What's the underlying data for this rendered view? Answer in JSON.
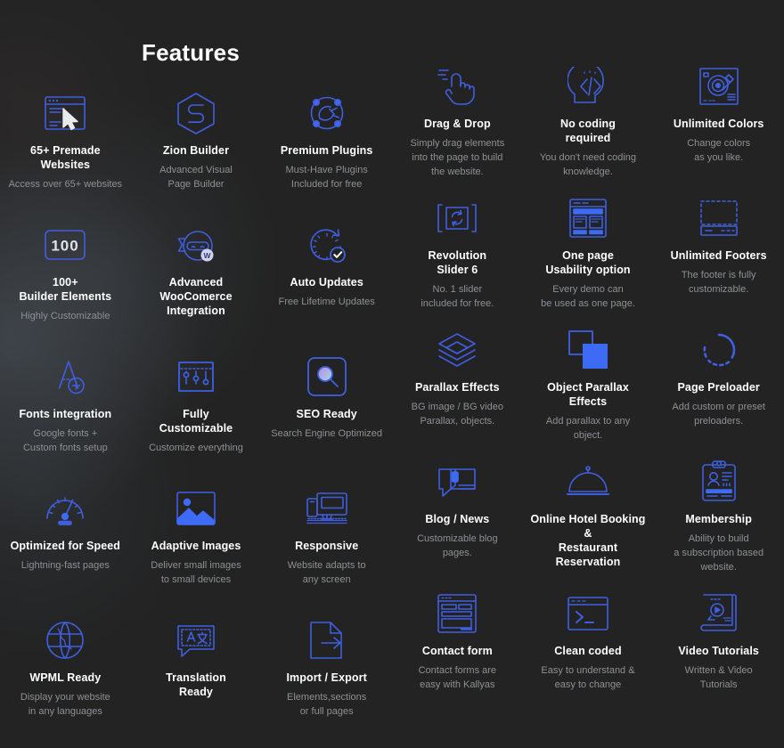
{
  "page": {
    "title": "Features"
  },
  "colors": {
    "background": "#232323",
    "accent_blue": "#3f5fe0",
    "accent_blue_bright": "#3d6bf5",
    "title_text": "#ffffff",
    "body_text": "#8d9095",
    "badge_light": "#cfd4f2",
    "seo_gradient_from": "#b48ad8",
    "seo_gradient_to": "#a8d8ee"
  },
  "left_group": [
    {
      "icon": "premade-websites-icon",
      "title": "65+ Premade\nWebsites",
      "desc": "Access over 65+ websites"
    },
    {
      "icon": "zion-builder-icon",
      "title": "Zion Builder",
      "desc": "Advanced Visual\nPage Builder"
    },
    {
      "icon": "premium-plugins-icon",
      "title": "Premium Plugins",
      "desc": "Must-Have Plugins\nIncluded for free"
    },
    {
      "icon": "builder-elements-icon",
      "title": "100+\nBuilder Elements",
      "desc": "Highly Customizable"
    },
    {
      "icon": "woocommerce-ninja-icon",
      "title": "Advanced\nWooComerce\nIntegration",
      "desc": ""
    },
    {
      "icon": "auto-updates-icon",
      "title": "Auto Updates",
      "desc": "Free Lifetime Updates"
    },
    {
      "icon": "fonts-integration-icon",
      "title": "Fonts integration",
      "desc": "Google fonts +\nCustom fonts setup"
    },
    {
      "icon": "fully-customizable-icon",
      "title": "Fully\nCustomizable",
      "desc": "Customize everything"
    },
    {
      "icon": "seo-ready-icon",
      "title": "SEO Ready",
      "desc": "Search Engine Optimized"
    },
    {
      "icon": "speed-gauge-icon",
      "title": "Optimized for Speed",
      "desc": "Lightning-fast pages"
    },
    {
      "icon": "adaptive-images-icon",
      "title": "Adaptive Images",
      "desc": "Deliver small images\nto small devices"
    },
    {
      "icon": "responsive-icon",
      "title": "Responsive",
      "desc": "Website adapts to\nany screen"
    },
    {
      "icon": "wpml-globe-icon",
      "title": "WPML Ready",
      "desc": "Display your website\nin any languages"
    },
    {
      "icon": "translation-icon",
      "title": "Translation\nReady",
      "desc": ""
    },
    {
      "icon": "import-export-icon",
      "title": "Import / Export",
      "desc": "Elements,sections\nor full pages"
    }
  ],
  "right_group": [
    {
      "icon": "drag-drop-icon",
      "title": "Drag & Drop",
      "desc": "Simply drag elements\ninto the page to build\nthe website."
    },
    {
      "icon": "no-coding-icon",
      "title": "No coding\nrequired",
      "desc": "You don't need coding\nknowledge."
    },
    {
      "icon": "unlimited-colors-icon",
      "title": "Unlimited Colors",
      "desc": "Change colors\nas you like."
    },
    {
      "icon": "revolution-slider-icon",
      "title": "Revolution\nSlider 6",
      "desc": "No. 1 slider\nincluded for free."
    },
    {
      "icon": "one-page-icon",
      "title": "One page\nUsability option",
      "desc": "Every demo can\nbe used as one page."
    },
    {
      "icon": "unlimited-footers-icon",
      "title": "Unlimited Footers",
      "desc": "The footer is fully\ncustomizable."
    },
    {
      "icon": "parallax-layers-icon",
      "title": "Parallax Effects",
      "desc": "BG image / BG video\nParallax, objects."
    },
    {
      "icon": "object-parallax-icon",
      "title": "Object Parallax\nEffects",
      "desc": "Add parallax to any\nobject."
    },
    {
      "icon": "page-preloader-icon",
      "title": "Page Preloader",
      "desc": "Add custom or preset\npreloaders."
    },
    {
      "icon": "blog-news-icon",
      "title": "Blog / News",
      "desc": "Customizable blog\npages."
    },
    {
      "icon": "hotel-booking-icon",
      "title": "Online Hotel Booking &\nRestaurant Reservation",
      "desc": ""
    },
    {
      "icon": "membership-icon",
      "title": "Membership",
      "desc": "Ability to build\na subscription based\nwebsite."
    },
    {
      "icon": "contact-form-icon",
      "title": "Contact form",
      "desc": "Contact forms are\neasy with Kallyas"
    },
    {
      "icon": "clean-coded-icon",
      "title": "Clean coded",
      "desc": "Easy to understand &\neasy to change"
    },
    {
      "icon": "video-tutorials-icon",
      "title": "Video Tutorials",
      "desc": "Written & Video\nTutorials"
    }
  ]
}
